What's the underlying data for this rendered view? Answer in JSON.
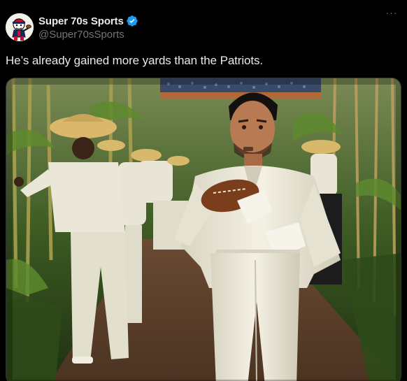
{
  "author": {
    "display_name": "Super 70s Sports",
    "handle": "@Super70sSports",
    "avatar_icon": "mascot-avatar-icon",
    "verified_icon": "verified-badge-icon",
    "verified_color": "#1d9bf0"
  },
  "more_icon": "more-options-icon",
  "more_label": "···",
  "tweet": {
    "text": "He’s already gained more yards than the Patriots."
  },
  "media": {
    "kind": "photo",
    "subject": "man-in-white-suit-holding-football"
  },
  "colors": {
    "background": "#000000",
    "text_primary": "#e7e9ea",
    "text_secondary": "#71767b"
  }
}
